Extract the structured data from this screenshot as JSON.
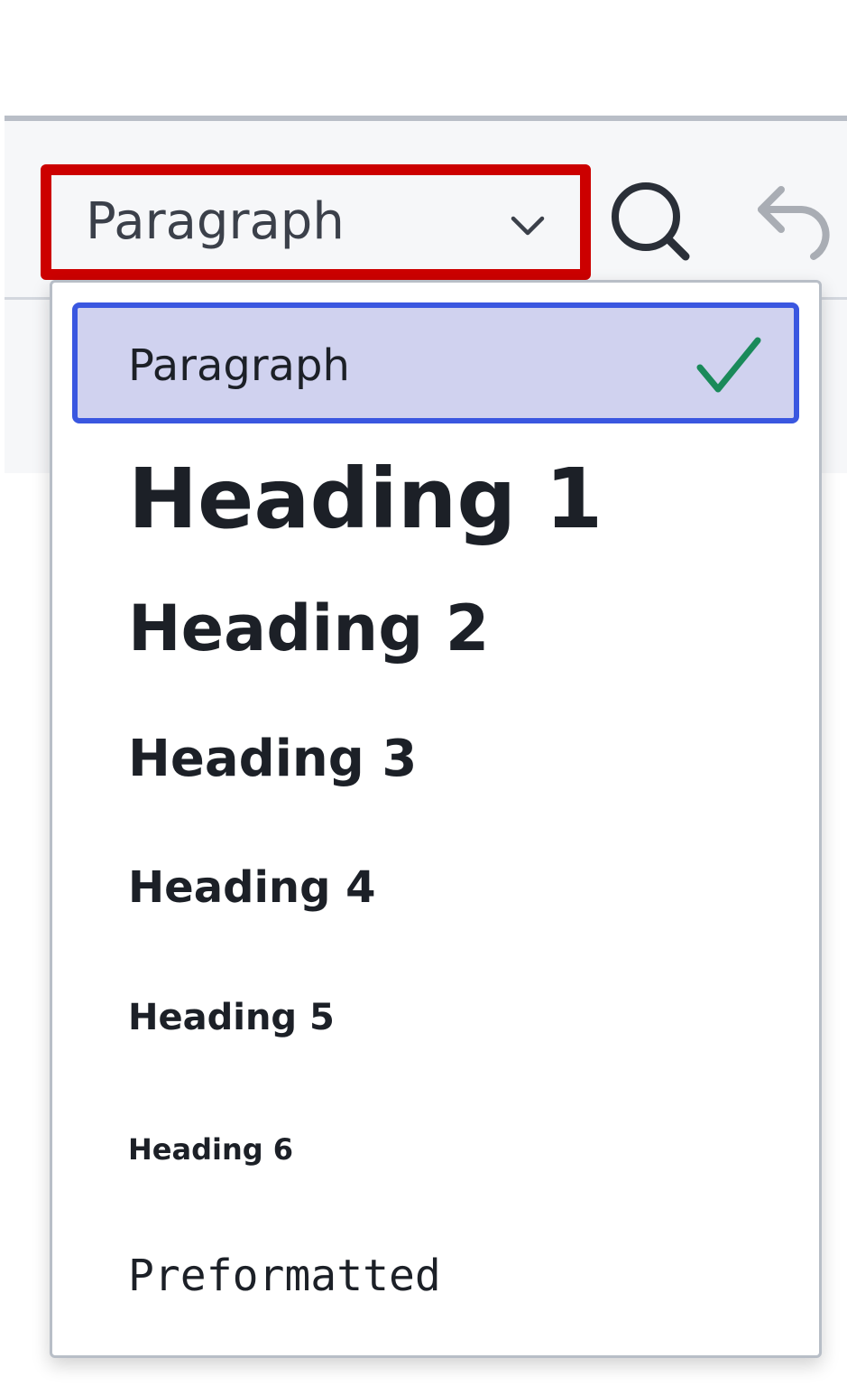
{
  "toolbar": {
    "format_select": {
      "value": "Paragraph",
      "icon": "chevron-down-icon"
    },
    "search_icon": "search-icon",
    "undo_icon": "undo-icon"
  },
  "dropdown": {
    "selected_index": 0,
    "items": [
      {
        "label": "Paragraph"
      },
      {
        "label": "Heading 1"
      },
      {
        "label": "Heading 2"
      },
      {
        "label": "Heading 3"
      },
      {
        "label": "Heading 4"
      },
      {
        "label": "Heading 5"
      },
      {
        "label": "Heading 6"
      },
      {
        "label": "Preformatted"
      }
    ]
  },
  "colors": {
    "highlight_border": "#cc0000",
    "selected_bg": "#d0d2ef",
    "selected_border": "#3a57e0",
    "check": "#1a8a5a",
    "text": "#1c2027"
  }
}
